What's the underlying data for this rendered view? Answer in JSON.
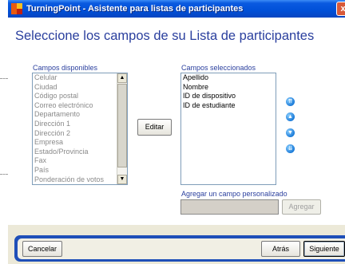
{
  "window": {
    "title": "TurningPoint - Asistente para listas de participantes",
    "close_glyph": "x",
    "app_icon": "turningpoint-logo"
  },
  "heading": "Seleccione los campos de su Lista de participantes",
  "available": {
    "label": "Campos disponibles",
    "items": [
      "Celular",
      "Ciudad",
      "Código postal",
      "Correo electrónico",
      "Departamento",
      "Dirección 1",
      "Dirección 2",
      "Empresa",
      "Estado/Provincia",
      "Fax",
      "País",
      "Ponderación de votos"
    ]
  },
  "selected": {
    "label": "Campos seleccionados",
    "items": [
      "Apellido",
      "Nombre",
      "ID de dispositivo",
      "ID de estudiante"
    ]
  },
  "edit_button": "Editar",
  "custom": {
    "label": "Agregar un campo personalizado",
    "value": "",
    "add_button": "Agregar"
  },
  "reorder_icons": [
    "move-top-icon",
    "move-up-icon",
    "move-down-icon",
    "move-bottom-icon"
  ],
  "footer": {
    "cancel": "Cancelar",
    "back": "Atrás",
    "next": "Siguiente"
  },
  "colors": {
    "heading": "#2a3f9e",
    "titlebar": "#0050d8",
    "footer_band": "#1f4fb8"
  }
}
